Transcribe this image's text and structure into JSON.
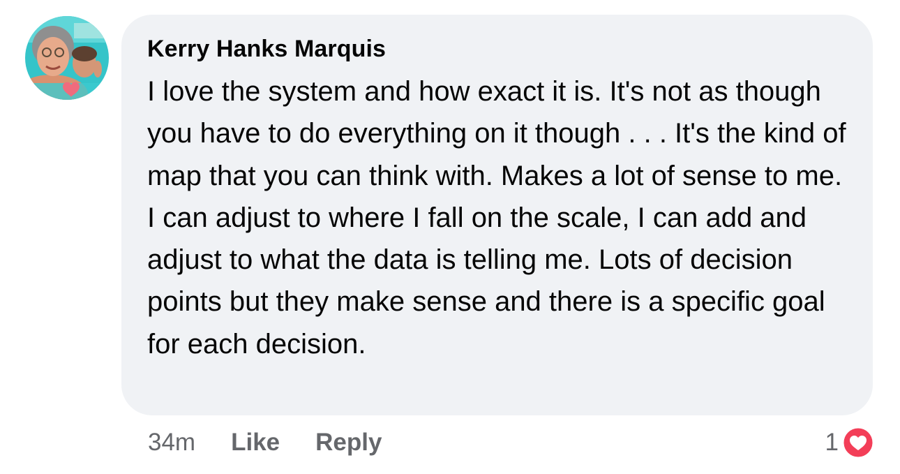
{
  "comment": {
    "author": "Kerry Hanks Marquis",
    "text": "I love the system and how exact it is. It's not as though you have to do everything on it though . . . It's the kind of map that you can think with. Makes a lot of sense to me. I can adjust to where I fall on the scale, I can add and adjust to what the data is telling me. Lots of decision points but they make sense and there is a specific goal for each decision.",
    "timestamp": "34m",
    "like_label": "Like",
    "reply_label": "Reply",
    "reaction_count": "1",
    "reaction_icon": "heart-icon"
  },
  "colors": {
    "bubble_background": "#f0f2f5",
    "text_primary": "#050505",
    "text_secondary": "#65676b",
    "reaction_heart": "#f33e58"
  }
}
